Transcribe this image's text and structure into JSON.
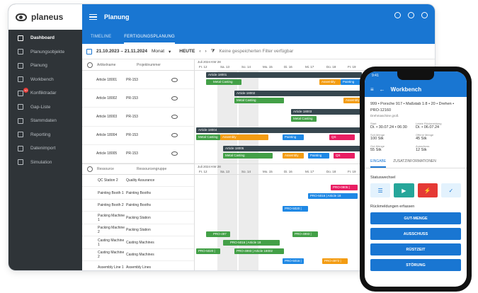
{
  "app": {
    "brand": "planeus",
    "title": "Planung"
  },
  "sidebar": {
    "items": [
      {
        "label": "Dashboard",
        "icon": "dashboard-icon"
      },
      {
        "label": "Planungsobjekte",
        "icon": "list-icon"
      },
      {
        "label": "Planung",
        "icon": "calendar-icon"
      },
      {
        "label": "Workbench",
        "icon": "bench-icon"
      },
      {
        "label": "Konfliktradar",
        "icon": "radar-icon",
        "badge": "10"
      },
      {
        "label": "Gap-Liste",
        "icon": "gap-icon"
      },
      {
        "label": "Stammdaten",
        "icon": "database-icon"
      },
      {
        "label": "Reporting",
        "icon": "chart-icon"
      },
      {
        "label": "Datenimport",
        "icon": "import-icon"
      },
      {
        "label": "Simulation",
        "icon": "simulation-icon"
      }
    ]
  },
  "tabs": [
    "TIMELINE",
    "FERTIGUNGSPLANUNG"
  ],
  "filter": {
    "range": "21.10.2023 – 21.11.2024",
    "scale": "Monat",
    "today": "HEUTE",
    "saved": "Keine gespeicherten Filter verfügbar"
  },
  "articles": {
    "headers": [
      "Artikelname",
      "Projektnummer"
    ],
    "week": "Juli 2024 KW 28",
    "rows": [
      [
        "Article 18001",
        "PR-153"
      ],
      [
        "Article 18002",
        "PR-153"
      ],
      [
        "Article 18003",
        "PR-153"
      ],
      [
        "Article 18004",
        "PR-153"
      ],
      [
        "Article 18005",
        "PR-153"
      ]
    ]
  },
  "days": [
    "Fr. 12",
    "Sa. 13",
    "So. 14",
    "Mo. 15",
    "Di. 16",
    "Mi. 17",
    "Do. 18",
    "Fr. 19"
  ],
  "resources": {
    "headers": [
      "Ressource",
      "Ressourcengruppe"
    ],
    "week": "Juli 2024 KW 28",
    "rows": [
      [
        "QC Station 2",
        "Quality Assurance"
      ],
      [
        "Painting Booth 1",
        "Painting Booths"
      ],
      [
        "Painting Booth 2",
        "Painting Booths"
      ],
      [
        "Packing Machine 1",
        "Packing Station"
      ],
      [
        "Packing Machine 2",
        "Packing Station"
      ],
      [
        "Casting Machine 1",
        "Casting Machines"
      ],
      [
        "Casting Machine 2",
        "Casting Machines"
      ],
      [
        "Assembly Line 1",
        "Assembly Lines"
      ]
    ]
  },
  "bars": {
    "a1": "Article 18001",
    "a2": "Article 18002",
    "a3": "Article 18003",
    "a4": "Article 18004",
    "a5": "Article 18005",
    "mc": "Metal Casting",
    "as": "Assembly",
    "pa": "Painting",
    "qs": "QS",
    "r1": "PRO-0905 |",
    "r2": "PRO-5016 | Article 18",
    "r3": "PRO-5020 |",
    "r4": "PRO-497",
    "r5": "PRO-5016 | Article 18",
    "r6": "PRO-4993 |",
    "r7": "PRO-5020 |",
    "r8": "PRO-4993 | Article 18002",
    "r9": "PRO-5016 |",
    "r10": "PRO-4972 |"
  },
  "phone": {
    "time": "9:41",
    "title": "Workbench",
    "order": "999 • Porsche 917 • Maßstab 1:8 • 20 • Drehen • PRO-12160",
    "machine": "Drehmaschine groß",
    "fields": [
      [
        "Start",
        "Di. • 30.07.24 • 06:30"
      ],
      [
        "Letzte Rückmeldung",
        "Di. • 06.07.24"
      ],
      [
        "Soll-Menge",
        "100 Stk"
      ],
      [
        "Offene Menge",
        "45 Stk"
      ],
      [
        "Gut-Menge",
        "55 Stk"
      ],
      [
        "Ausschuss",
        "12 Stk"
      ]
    ],
    "tabs": [
      "EINGABE",
      "ZUSATZINFORMATIONEN"
    ],
    "status_h": "Statuswechsel",
    "feedback_h": "Rückmeldungen erfassen",
    "buttons": [
      "GUT-MENGE",
      "AUSSCHUSS",
      "RÜSTZEIT",
      "STÖRUNG"
    ]
  },
  "colors": {
    "primary": "#1976d2",
    "sidebar": "#2f3438",
    "green": "#43a047",
    "orange": "#f39c12",
    "blue": "#1e88e5",
    "pink": "#e91e63",
    "dark": "#37474f"
  }
}
